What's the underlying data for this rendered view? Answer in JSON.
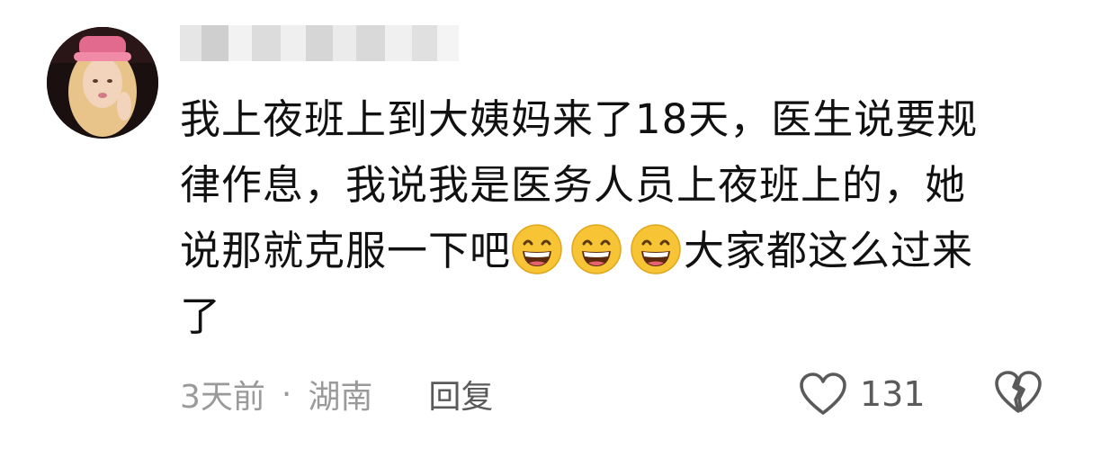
{
  "comment": {
    "lines": [
      "我上夜班上到大姨妈来了18天，医生说要规",
      "律作息，我说我是医务人员上夜班上的，她",
      "说那就克服一下吧",
      "大家都这么过来",
      "了"
    ],
    "emoji": [
      "grinning-emoji",
      "grinning-emoji",
      "grinning-emoji"
    ]
  },
  "meta": {
    "time": "3天前",
    "separator": "·",
    "location": "湖南",
    "reply_label": "回复"
  },
  "actions": {
    "like_count": "131",
    "like_icon": "heart-outline-icon",
    "dislike_icon": "broken-heart-icon"
  }
}
